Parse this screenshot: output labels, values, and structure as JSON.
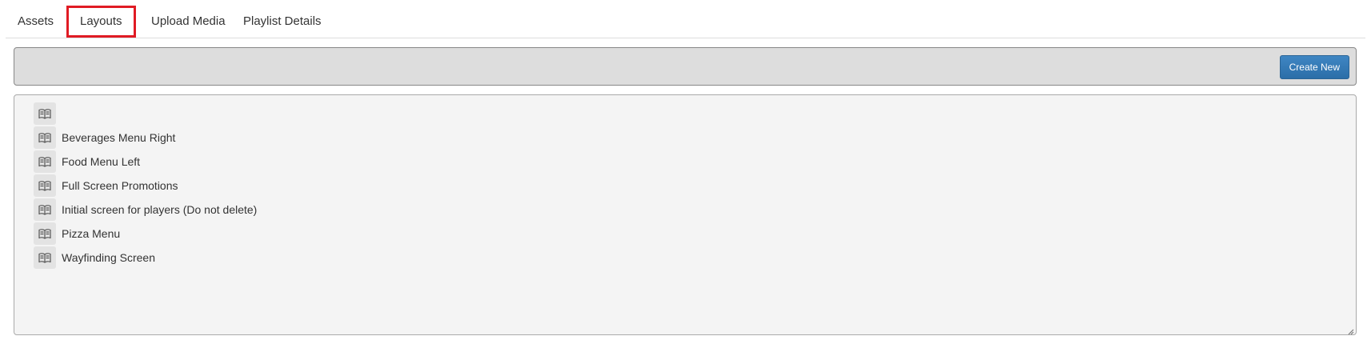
{
  "tabs": [
    {
      "label": "Assets",
      "active": false
    },
    {
      "label": "Layouts",
      "active": true
    },
    {
      "label": "Upload Media",
      "active": false
    },
    {
      "label": "Playlist Details",
      "active": false
    }
  ],
  "toolbar": {
    "create_label": "Create New"
  },
  "layouts": [
    {
      "label": "",
      "icon": "book-icon"
    },
    {
      "label": "Beverages Menu Right",
      "icon": "book-icon"
    },
    {
      "label": "Food Menu Left",
      "icon": "book-icon"
    },
    {
      "label": "Full Screen Promotions",
      "icon": "book-icon"
    },
    {
      "label": "Initial screen for players (Do not delete)",
      "icon": "book-icon"
    },
    {
      "label": "Pizza Menu",
      "icon": "book-icon"
    },
    {
      "label": "Wayfinding Screen",
      "icon": "book-icon"
    }
  ],
  "colors": {
    "highlight": "#e01b24",
    "button": "#337ab7",
    "toolbar_bg": "#dddddd",
    "panel_bg": "#f4f4f4"
  }
}
